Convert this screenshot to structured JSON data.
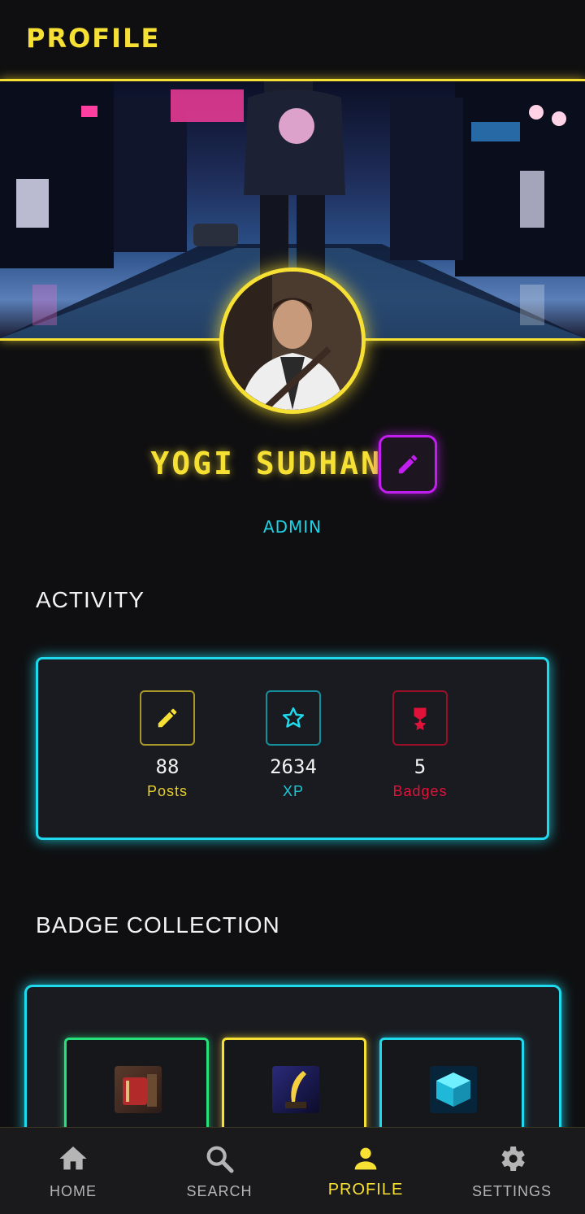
{
  "header": {
    "title": "PROFILE"
  },
  "profile": {
    "name": "YOGI SUDHAN",
    "role": "ADMIN"
  },
  "activity": {
    "title": "ACTIVITY",
    "stats": [
      {
        "icon": "pencil-icon",
        "value": "88",
        "label": "Posts",
        "color": "#e6cf2e"
      },
      {
        "icon": "star-icon",
        "value": "2634",
        "label": "XP",
        "color": "#19c8d8"
      },
      {
        "icon": "medal-icon",
        "value": "5",
        "label": "Badges",
        "color": "#e0123a"
      }
    ]
  },
  "badge_collection": {
    "title": "BADGE COLLECTION",
    "badges": [
      {
        "icon": "book-badge-icon",
        "color": "#26e07a"
      },
      {
        "icon": "quill-badge-icon",
        "color": "#f7e034"
      },
      {
        "icon": "cube-badge-icon",
        "color": "#1fd9ec"
      }
    ]
  },
  "nav": {
    "items": [
      {
        "icon": "home-icon",
        "label": "HOME",
        "active": false
      },
      {
        "icon": "search-icon",
        "label": "SEARCH",
        "active": false
      },
      {
        "icon": "person-icon",
        "label": "PROFILE",
        "active": true
      },
      {
        "icon": "gear-icon",
        "label": "SETTINGS",
        "active": false
      }
    ]
  },
  "colors": {
    "accent": "#f7e034",
    "cyan": "#1fd9ec",
    "magenta": "#c21ef0",
    "background": "#0f0f11"
  }
}
